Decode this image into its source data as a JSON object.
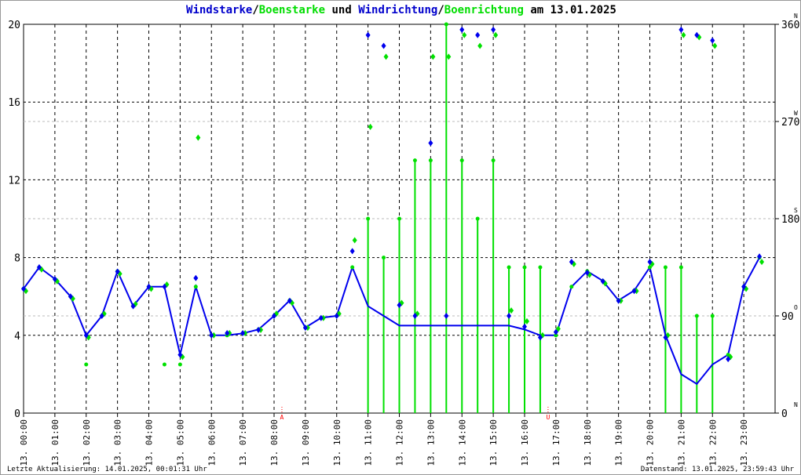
{
  "title": {
    "part1": "Windstarke",
    "sep1": "/",
    "part2": "Boenstarke",
    "mid": " und ",
    "part3": "Windrichtung",
    "sep2": "/",
    "part4": "Boenrichtung",
    "end": " am 13.01.2025"
  },
  "footer": {
    "left": "Letzte Aktualisierung: 14.01.2025, 00:01:31 Uhr",
    "right": "Datenstand: 13.01.2025, 23:59:43 Uhr"
  },
  "colors": {
    "wind": "#0000ee",
    "gust": "#00e000",
    "marker": "#ff0000"
  },
  "chart_data": {
    "type": "line",
    "title": "Windstarke/Boenstarke und Windrichtung/Boenrichtung am 13.01.2025",
    "left_axis": {
      "ylim": [
        0,
        20
      ],
      "ticks": [
        "0",
        "4",
        "8",
        "12",
        "16",
        "20"
      ]
    },
    "right_axis": {
      "ylim": [
        0,
        360
      ],
      "ticks": [
        {
          "value": "0",
          "dir": "N"
        },
        {
          "value": "90",
          "dir": "O"
        },
        {
          "value": "180",
          "dir": "S"
        },
        {
          "value": "270",
          "dir": "W"
        },
        {
          "value": "360",
          "dir": "N"
        }
      ]
    },
    "x_tick_labels": [
      "13. 00:00",
      "13. 01:00",
      "13. 02:00",
      "13. 03:00",
      "13. 04:00",
      "13. 05:00",
      "13. 06:00",
      "13. 07:00",
      "13. 08:00",
      "13. 09:00",
      "13. 10:00",
      "13. 11:00",
      "13. 12:00",
      "13. 13:00",
      "13. 14:00",
      "13. 15:00",
      "13. 16:00",
      "13. 17:00",
      "13. 18:00",
      "13. 19:00",
      "13. 20:00",
      "13. 21:00",
      "13. 22:00",
      "13. 23:00"
    ],
    "markers": [
      {
        "label": "A",
        "hour": 8.25
      },
      {
        "label": "U",
        "hour": 16.75
      }
    ],
    "x_hours": [
      0,
      0.5,
      1,
      1.5,
      2,
      2.5,
      3,
      3.5,
      4,
      4.5,
      5,
      5.5,
      6,
      6.5,
      7,
      7.5,
      8,
      8.5,
      9,
      9.5,
      10,
      10.5,
      11,
      11.5,
      12,
      12.5,
      13,
      13.5,
      14,
      14.5,
      15,
      15.5,
      16,
      16.5,
      17,
      17.5,
      18,
      18.5,
      19,
      19.5,
      20,
      20.5,
      21,
      21.5,
      22,
      22.5,
      23,
      23.5
    ],
    "series": [
      {
        "name": "Windstarke",
        "values": [
          6.4,
          7.5,
          6.9,
          6.0,
          4.0,
          5.0,
          7.3,
          5.5,
          6.5,
          6.5,
          3.0,
          6.5,
          4.0,
          4.0,
          4.1,
          4.3,
          5.0,
          5.8,
          4.4,
          4.9,
          5.0,
          7.5,
          5.5,
          5.0,
          4.5,
          4.5,
          4.5,
          4.5,
          4.5,
          4.5,
          4.5,
          4.5,
          4.3,
          4.0,
          4.0,
          6.5,
          7.3,
          6.8,
          5.8,
          6.3,
          7.5,
          4.0,
          2.0,
          1.5,
          2.5,
          3.0,
          6.5,
          8.0
        ]
      },
      {
        "name": "Boenstarke",
        "values": [
          6.4,
          7.5,
          6.9,
          6.0,
          2.5,
          5.0,
          7.3,
          5.5,
          6.5,
          2.5,
          2.5,
          6.5,
          4.0,
          4.0,
          4.1,
          4.3,
          5.0,
          5.8,
          4.4,
          4.9,
          5.0,
          7.5,
          10.0,
          8.0,
          10.0,
          13.0,
          13.0,
          20.0,
          13.0,
          10.0,
          13.0,
          7.5,
          7.5,
          7.5,
          4.0,
          6.5,
          7.3,
          6.8,
          5.8,
          6.3,
          7.5,
          7.5,
          7.5,
          5.0,
          5.0,
          3.0,
          6.5,
          8.0
        ]
      },
      {
        "name": "Windrichtung",
        "values": [
          115,
          135,
          124,
          108,
          72,
          90,
          131,
          99,
          117,
          117,
          54,
          125,
          72,
          74,
          74,
          77,
          90,
          104,
          79,
          88,
          90,
          150,
          350,
          340,
          100,
          90,
          250,
          90,
          355,
          350,
          355,
          90,
          80,
          70,
          75,
          140,
          130,
          122,
          104,
          113,
          140,
          70,
          355,
          350,
          345,
          50,
          117,
          145
        ]
      },
      {
        "name": "Boenrichtung",
        "values": [
          113,
          133,
          122,
          106,
          70,
          92,
          129,
          101,
          115,
          119,
          52,
          255,
          72,
          74,
          74,
          77,
          92,
          102,
          79,
          88,
          92,
          160,
          265,
          330,
          102,
          92,
          330,
          330,
          350,
          340,
          350,
          95,
          85,
          72,
          78,
          138,
          128,
          120,
          104,
          113,
          138,
          72,
          350,
          348,
          340,
          52,
          115,
          140
        ]
      }
    ]
  }
}
